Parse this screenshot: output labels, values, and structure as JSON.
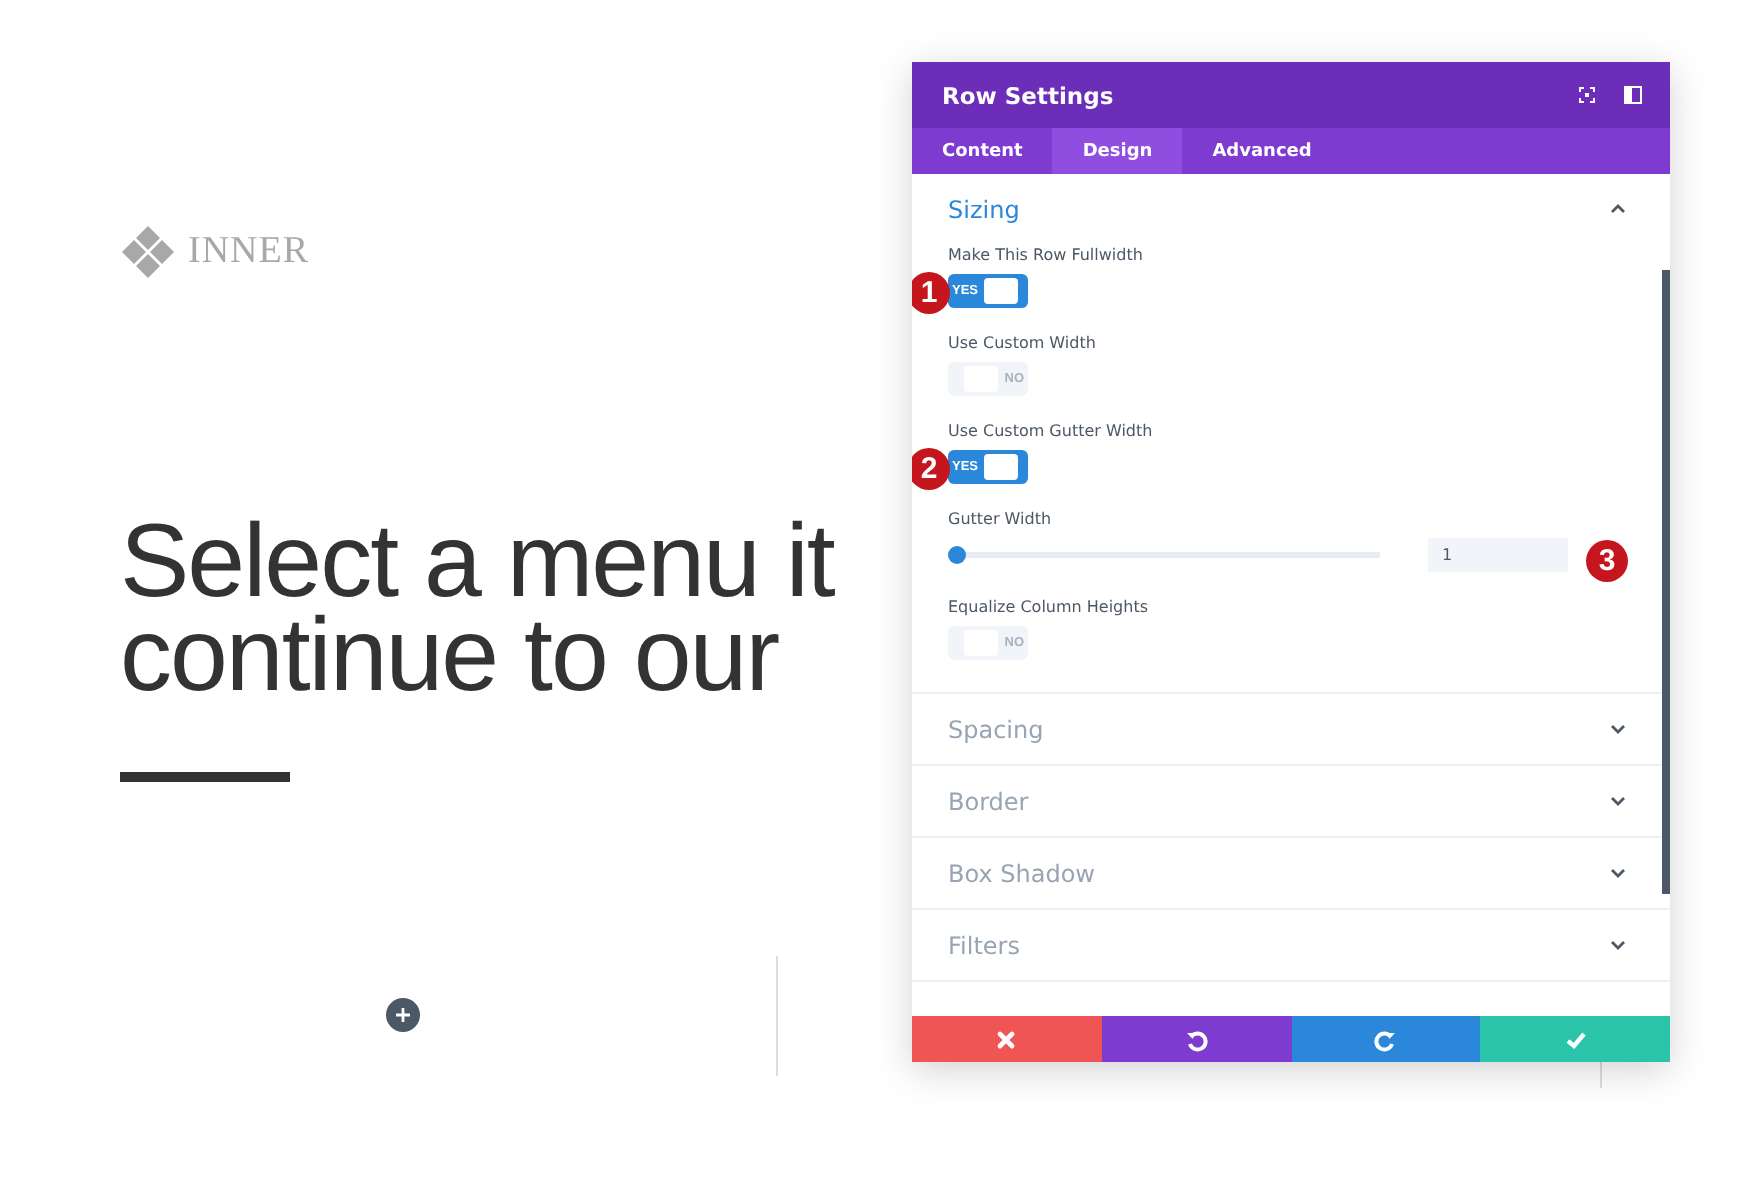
{
  "logo": {
    "text": "INNER"
  },
  "heading": {
    "lines": [
      "Select a menu it",
      "continue to our"
    ]
  },
  "modal": {
    "title": "Row Settings",
    "tabs": [
      {
        "label": "Content",
        "selected": false
      },
      {
        "label": "Design",
        "selected": true
      },
      {
        "label": "Advanced",
        "selected": false
      }
    ],
    "sections": [
      {
        "title": "Sizing",
        "expanded": true,
        "settings": [
          {
            "kind": "toggle",
            "label": "Make This Row Fullwidth",
            "on": true,
            "state_text": "YES",
            "badge": "1"
          },
          {
            "kind": "toggle",
            "label": "Use Custom Width",
            "on": false,
            "state_text": "NO"
          },
          {
            "kind": "toggle",
            "label": "Use Custom Gutter Width",
            "on": true,
            "state_text": "YES",
            "badge": "2"
          },
          {
            "kind": "slider",
            "label": "Gutter Width",
            "level": 0,
            "value": "1",
            "badge": "3"
          },
          {
            "kind": "toggle",
            "label": "Equalize Column Heights",
            "on": false,
            "state_text": "NO"
          }
        ]
      },
      {
        "title": "Spacing",
        "expanded": false
      },
      {
        "title": "Border",
        "expanded": false
      },
      {
        "title": "Box Shadow",
        "expanded": false
      },
      {
        "title": "Filters",
        "expanded": false
      }
    ],
    "actions": [
      {
        "kind": "cancel"
      },
      {
        "kind": "undo"
      },
      {
        "kind": "redo"
      },
      {
        "kind": "save"
      }
    ]
  }
}
